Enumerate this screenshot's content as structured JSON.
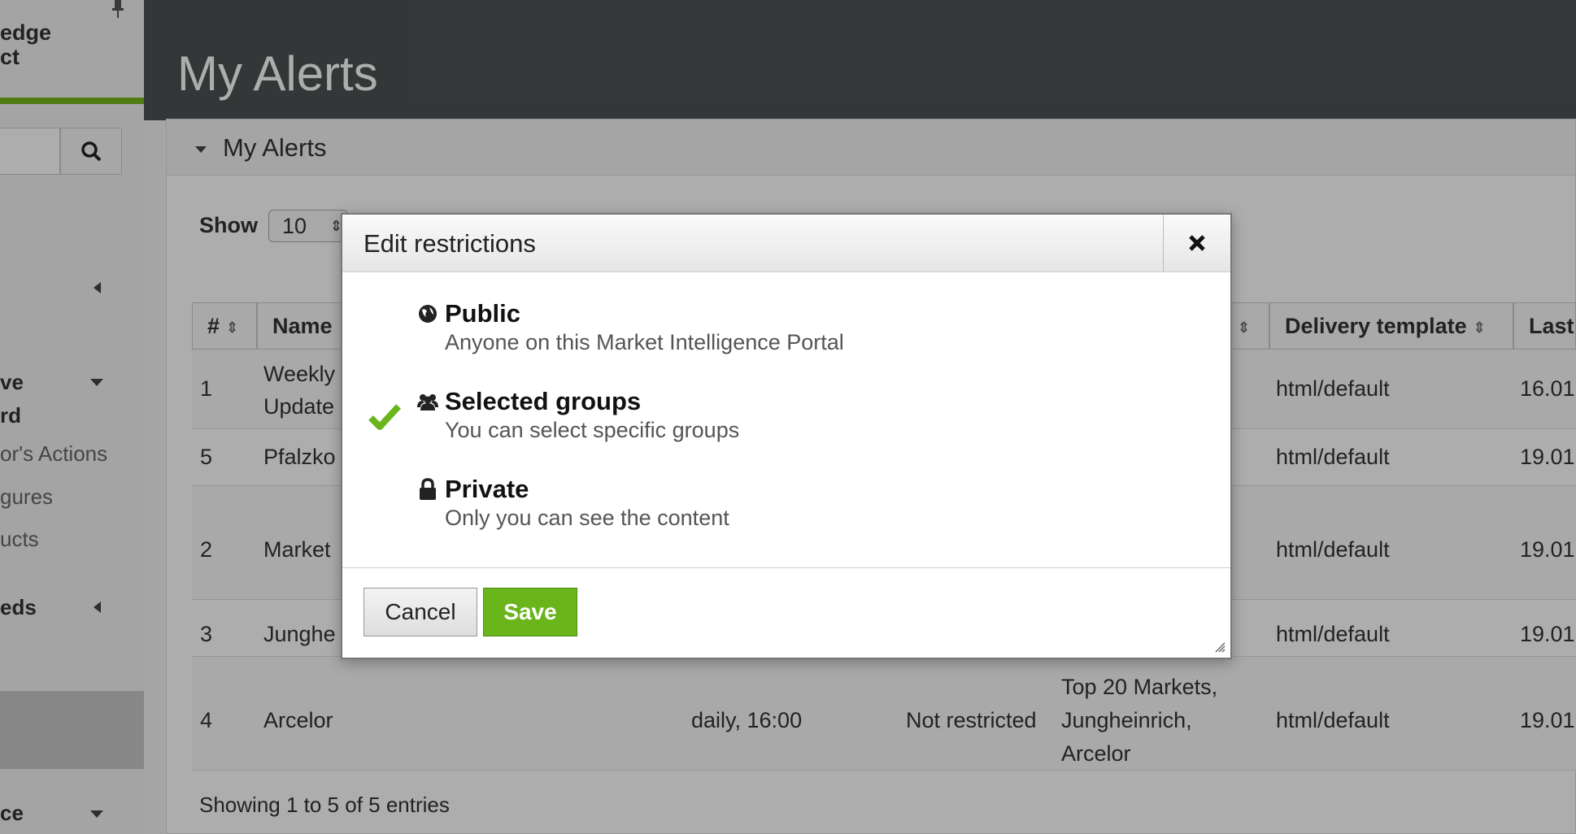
{
  "sidebar": {
    "brand_line1": "edge",
    "brand_line2": "ct",
    "items": [
      {
        "label": "ve",
        "label2": "rd"
      },
      {
        "label": "or's Actions"
      },
      {
        "label": "gures"
      },
      {
        "label": "ucts"
      },
      {
        "label": "eds"
      },
      {
        "label": "ce"
      }
    ]
  },
  "header": {
    "title": "My Alerts"
  },
  "panel": {
    "title": "My Alerts",
    "show_label": "Show",
    "show_value": "10",
    "columns": [
      "#",
      "Name",
      "Delivery template",
      "Last"
    ],
    "rows": [
      {
        "num": "1",
        "name": "Weekly",
        "name2": "Update",
        "template": "html/default",
        "last": "16.01"
      },
      {
        "num": "5",
        "name": "Pfalzko",
        "template": "html/default",
        "last": "19.01"
      },
      {
        "num": "2",
        "name": "Market",
        "template": "html/default",
        "last": "19.01"
      },
      {
        "num": "3",
        "name": "Junghe",
        "template": "html/default",
        "last": "19.01"
      },
      {
        "num": "4",
        "name": "Arcelor",
        "schedule": "daily, 16:00",
        "restriction": "Not restricted",
        "groups1": "Top 20 Markets,",
        "groups2": "Jungheinrich,",
        "groups3": "Arcelor",
        "template": "html/default",
        "last": "19.01"
      }
    ],
    "footer": "Showing 1 to 5 of 5 entries"
  },
  "modal": {
    "title": "Edit restrictions",
    "options": [
      {
        "title": "Public",
        "desc": "Anyone on this Market Intelligence Portal",
        "icon": "globe-icon",
        "selected": false
      },
      {
        "title": "Selected groups",
        "desc": "You can select specific groups",
        "icon": "group-icon",
        "selected": true
      },
      {
        "title": "Private",
        "desc": "Only you can see the content",
        "icon": "lock-icon",
        "selected": false
      }
    ],
    "cancel_label": "Cancel",
    "save_label": "Save"
  },
  "colors": {
    "accent": "#6ab41c",
    "topbar": "#4c5253"
  }
}
